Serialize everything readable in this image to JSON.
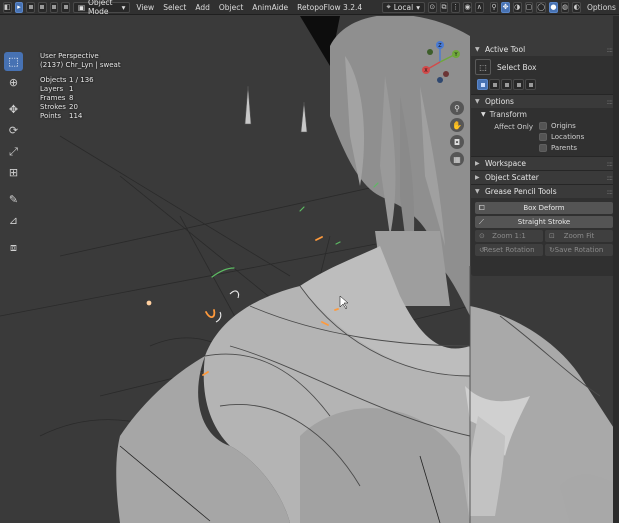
{
  "header": {
    "mode": "Object Mode",
    "menus": [
      "View",
      "Select",
      "Add",
      "Object",
      "AnimAide",
      "RetopoFlow 3.2.4"
    ],
    "orientation": "Local",
    "options_label": "Options"
  },
  "viewport": {
    "perspective": "User Perspective",
    "object_line": "(2137) Chr_Lyn | sweat",
    "stats": [
      {
        "label": "Objects",
        "value": "1 / 136"
      },
      {
        "label": "Layers",
        "value": "1"
      },
      {
        "label": "Frames",
        "value": "8"
      },
      {
        "label": "Strokes",
        "value": "20"
      },
      {
        "label": "Points",
        "value": "114"
      }
    ],
    "gizmo": {
      "x_label": "X",
      "y_label": "Y",
      "z_label": "Z"
    }
  },
  "toolbar_icons": [
    "select-box-icon",
    "cursor-icon",
    "move-icon",
    "rotate-icon",
    "scale-icon",
    "transform-icon",
    "annotate-icon",
    "measure-icon",
    "add-cube-icon"
  ],
  "sidebar": {
    "active_tool": {
      "title": "Active Tool",
      "tool_name": "Select Box"
    },
    "options": {
      "title": "Options",
      "transform": "Transform",
      "affect_only": "Affect Only",
      "checks": [
        "Origins",
        "Locations",
        "Parents"
      ]
    },
    "workspace": "Workspace",
    "object_scatter": "Object Scatter",
    "grease_pencil": {
      "title": "Grease Pencil Tools",
      "box_deform": "Box Deform",
      "straight_stroke": "Straight Stroke",
      "zoom_1_1": "Zoom 1:1",
      "zoom_fit": "Zoom Fit",
      "reset_rotation": "Reset Rotation",
      "save_rotation": "Save Rotation"
    }
  },
  "colors": {
    "accent": "#4772b3",
    "axis_x": "#d24a4a",
    "axis_y": "#6fa83a",
    "axis_z": "#4a7ad2"
  }
}
